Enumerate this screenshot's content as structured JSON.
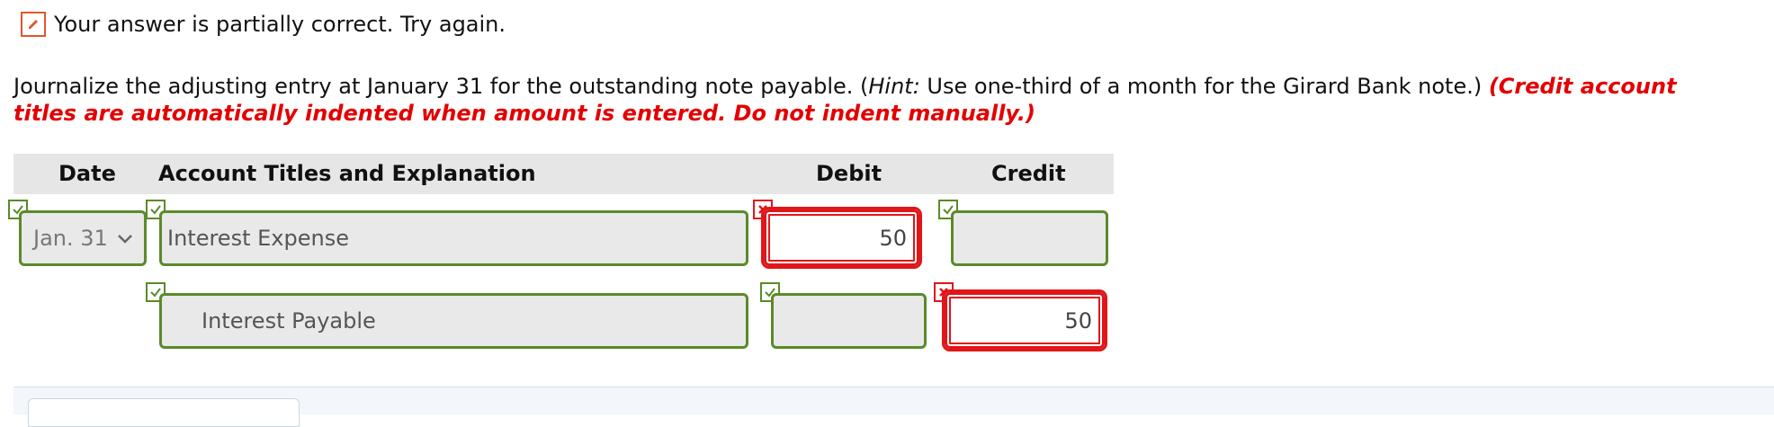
{
  "status": {
    "message": "Your answer is partially correct.  Try again."
  },
  "question": {
    "text_before_hint": "Journalize the adjusting entry at January 31 for the outstanding note payable. (",
    "hint_label": "Hint:",
    "hint_text": " Use one-third of a month for the Girard Bank note.) ",
    "instruction": "(Credit account titles are automatically indented when amount is entered. Do not indent manually.)"
  },
  "table": {
    "headers": {
      "date": "Date",
      "account": "Account Titles and Explanation",
      "debit": "Debit",
      "credit": "Credit"
    },
    "rows": [
      {
        "date": "Jan. 31",
        "account": "Interest Expense",
        "debit": "50",
        "credit": "",
        "status": {
          "date": "correct",
          "account": "correct",
          "debit": "incorrect",
          "credit": "correct"
        }
      },
      {
        "date": "",
        "account": "Interest Payable",
        "debit": "",
        "credit": "50",
        "status": {
          "account": "correct",
          "debit": "correct",
          "credit": "incorrect"
        }
      }
    ]
  },
  "colors": {
    "correct": "#5a8a2a",
    "incorrect": "#e0161a",
    "instruction": "#e40000",
    "header_bg": "#e6e6e6"
  }
}
